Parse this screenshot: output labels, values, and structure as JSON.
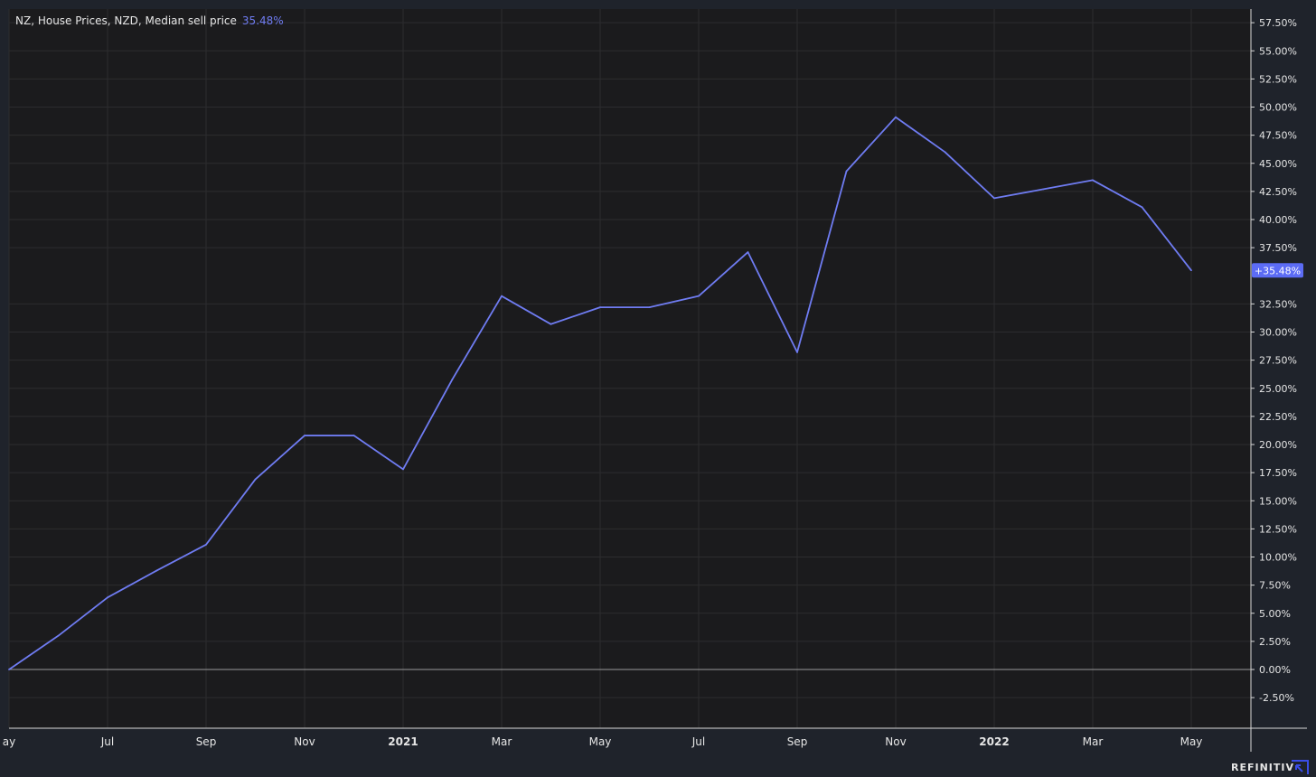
{
  "legend": {
    "series_label": "NZ, House Prices, NZD, Median sell price",
    "last_value": "35.48%"
  },
  "price_tag": "+35.48%",
  "brand": {
    "name": "REFINITIV",
    "icon": "refinitiv-logo-icon"
  },
  "colors": {
    "background": "#1b1b1d",
    "frame": "#1f232b",
    "grid": "#2c2c2f",
    "line": "#6f7cf2",
    "tag_bg": "#5c6cf5",
    "axis_text": "#e6e6e6",
    "zero_line": "#9a9a9a"
  },
  "chart_data": {
    "type": "line",
    "title": "NZ, House Prices, NZD, Median sell price",
    "xlabel": "",
    "ylabel": "",
    "y_unit": "%",
    "ylim": [
      -4.5,
      58.75
    ],
    "y_ticks": [
      57.5,
      55,
      52.5,
      50,
      47.5,
      45,
      42.5,
      40,
      37.5,
      32.5,
      30,
      27.5,
      25,
      22.5,
      20,
      17.5,
      15,
      12.5,
      10,
      7.5,
      5,
      2.5,
      0,
      -2.5
    ],
    "y_tick_labels": [
      "57.50%",
      "55.00%",
      "52.50%",
      "50.00%",
      "47.50%",
      "45.00%",
      "42.50%",
      "40.00%",
      "37.50%",
      "32.50%",
      "30.00%",
      "27.50%",
      "25.00%",
      "22.50%",
      "20.00%",
      "17.50%",
      "15.00%",
      "12.50%",
      "10.00%",
      "7.50%",
      "5.00%",
      "2.50%",
      "0.00%",
      "-2.50%"
    ],
    "x_ticks": [
      {
        "label": "ay",
        "x": "2020-05",
        "bold": false
      },
      {
        "label": "Jul",
        "x": "2020-07",
        "bold": false
      },
      {
        "label": "Sep",
        "x": "2020-09",
        "bold": false
      },
      {
        "label": "Nov",
        "x": "2020-11",
        "bold": false
      },
      {
        "label": "2021",
        "x": "2021-01",
        "bold": true
      },
      {
        "label": "Mar",
        "x": "2021-03",
        "bold": false
      },
      {
        "label": "May",
        "x": "2021-05",
        "bold": false
      },
      {
        "label": "Jul",
        "x": "2021-07",
        "bold": false
      },
      {
        "label": "Sep",
        "x": "2021-09",
        "bold": false
      },
      {
        "label": "Nov",
        "x": "2021-11",
        "bold": false
      },
      {
        "label": "2022",
        "x": "2022-01",
        "bold": true
      },
      {
        "label": "Mar",
        "x": "2022-03",
        "bold": false
      },
      {
        "label": "May",
        "x": "2022-05",
        "bold": false
      }
    ],
    "x_range": [
      "2020-05",
      "2022-06"
    ],
    "grid": true,
    "series": [
      {
        "x": [
          "2020-05",
          "2020-06",
          "2020-07",
          "2020-08",
          "2020-09",
          "2020-10",
          "2020-11",
          "2020-12",
          "2021-01",
          "2021-02",
          "2021-03",
          "2021-04",
          "2021-05",
          "2021-06",
          "2021-07",
          "2021-08",
          "2021-09",
          "2021-10",
          "2021-11",
          "2021-12",
          "2022-01",
          "2022-02",
          "2022-03",
          "2022-04",
          "2022-05"
        ],
        "values": [
          0,
          3.0,
          6.4,
          8.8,
          11.1,
          16.9,
          20.8,
          20.8,
          17.8,
          25.8,
          33.2,
          30.7,
          32.2,
          32.2,
          33.2,
          37.1,
          28.2,
          44.3,
          49.1,
          46.0,
          41.9,
          42.7,
          43.5,
          41.1,
          35.48
        ]
      }
    ],
    "last_value": 35.48
  }
}
